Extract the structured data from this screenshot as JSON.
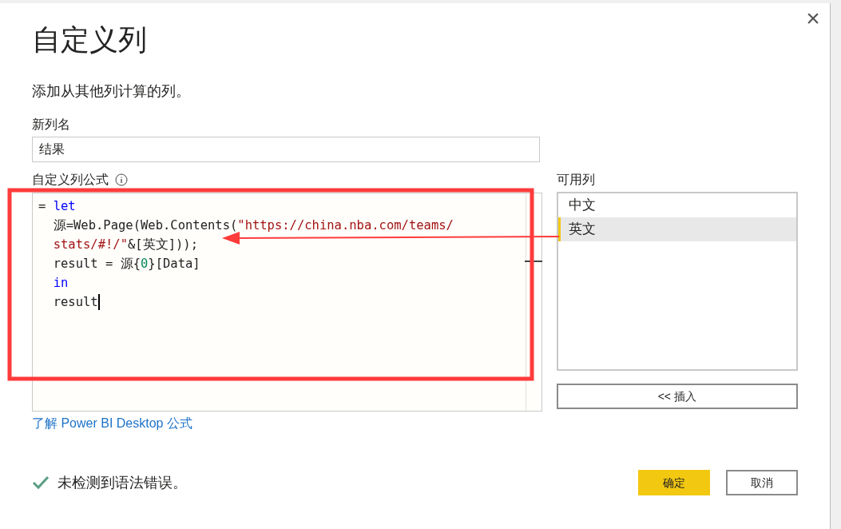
{
  "dialog": {
    "title": "自定义列",
    "subtitle": "添加从其他列计算的列。",
    "close_label": "×"
  },
  "new_column": {
    "label": "新列名",
    "value": "结果"
  },
  "formula": {
    "label": "自定义列公式",
    "lines": [
      [
        {
          "kind": "plain",
          "text": "= "
        },
        {
          "kind": "keyword",
          "text": "let"
        }
      ],
      [
        {
          "kind": "plain",
          "text": "  源=Web.Page(Web.Contents("
        },
        {
          "kind": "string",
          "text": "\"https://china.nba.com/teams/"
        }
      ],
      [
        {
          "kind": "string",
          "text": "  stats/#!/\""
        },
        {
          "kind": "plain",
          "text": "&[英文]));"
        }
      ],
      [
        {
          "kind": "plain",
          "text": "  result = 源{"
        },
        {
          "kind": "number",
          "text": "0"
        },
        {
          "kind": "plain",
          "text": "}[Data]"
        }
      ],
      [
        {
          "kind": "keyword",
          "text": "  in"
        }
      ],
      [
        {
          "kind": "plain",
          "text": "  result"
        }
      ]
    ]
  },
  "available_columns": {
    "label": "可用列",
    "items": [
      {
        "text": "中文",
        "selected": false
      },
      {
        "text": "英文",
        "selected": true
      }
    ],
    "insert_button": "<< 插入"
  },
  "learn_link": "了解 Power BI Desktop 公式",
  "status": {
    "ok": true,
    "text": "未检测到语法错误。"
  },
  "buttons": [
    {
      "text": "确定",
      "primary": true
    },
    {
      "text": "取消",
      "primary": false
    }
  ]
}
